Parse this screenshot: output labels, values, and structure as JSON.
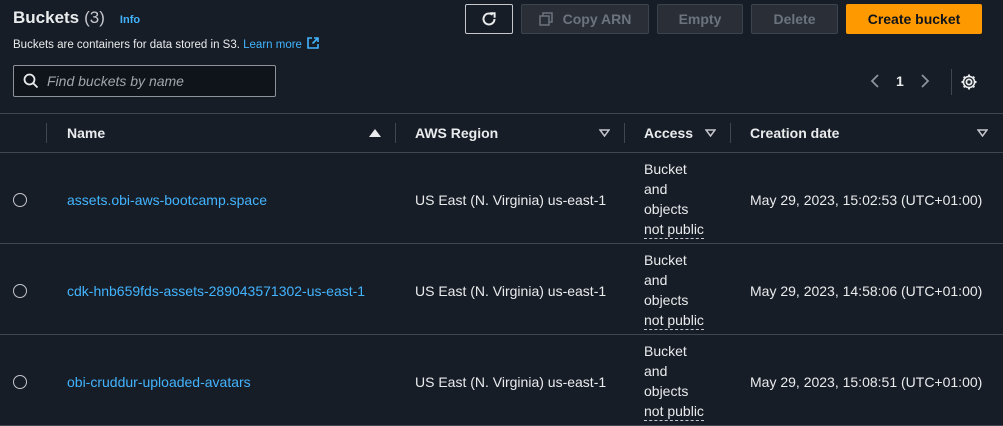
{
  "header": {
    "title": "Buckets",
    "count": "(3)",
    "info_link": "Info",
    "description": "Buckets are containers for data stored in S3.",
    "learn_more": "Learn more"
  },
  "toolbar": {
    "refresh_icon": "refresh-icon",
    "copy_arn_label": "Copy ARN",
    "empty_label": "Empty",
    "delete_label": "Delete",
    "create_label": "Create bucket",
    "accent_color": "#ff9900"
  },
  "search": {
    "placeholder": "Find buckets by name",
    "value": ""
  },
  "pagination": {
    "current_page": "1"
  },
  "table": {
    "columns": [
      "Name",
      "AWS Region",
      "Access",
      "Creation date"
    ],
    "rows": [
      {
        "name": "assets.obi-aws-bootcamp.space",
        "region": "US East (N. Virginia) us-east-1",
        "access_lines": [
          "Bucket",
          "and",
          "objects",
          "not public"
        ],
        "created": "May 29, 2023, 15:02:53 (UTC+01:00)"
      },
      {
        "name": "cdk-hnb659fds-assets-289043571302-us-east-1",
        "region": "US East (N. Virginia) us-east-1",
        "access_lines": [
          "Bucket",
          "and",
          "objects",
          "not public"
        ],
        "created": "May 29, 2023, 14:58:06 (UTC+01:00)"
      },
      {
        "name": "obi-cruddur-uploaded-avatars",
        "region": "US East (N. Virginia) us-east-1",
        "access_lines": [
          "Bucket",
          "and",
          "objects",
          "not public"
        ],
        "created": "May 29, 2023, 15:08:51 (UTC+01:00)"
      }
    ]
  }
}
